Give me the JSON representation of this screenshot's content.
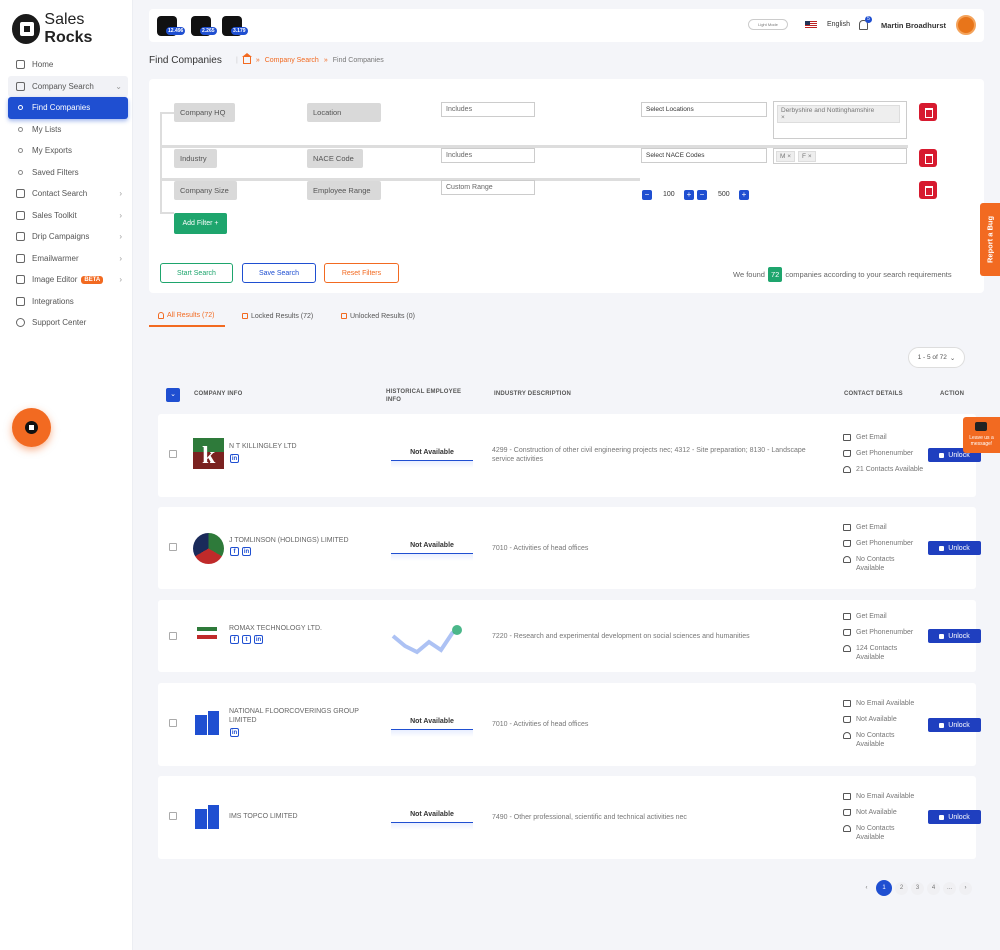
{
  "brand": {
    "name_a": "Sales ",
    "name_b": "Rocks"
  },
  "sidebar": {
    "items": [
      {
        "label": "Home"
      },
      {
        "label": "Company Search"
      },
      {
        "label": "Find Companies"
      },
      {
        "label": "My Lists"
      },
      {
        "label": "My Exports"
      },
      {
        "label": "Saved Filters"
      },
      {
        "label": "Contact Search"
      },
      {
        "label": "Sales Toolkit"
      },
      {
        "label": "Drip Campaigns"
      },
      {
        "label": "Emailwarmer"
      },
      {
        "label": "Image Editor",
        "badge": "BETA"
      },
      {
        "label": "Integrations"
      },
      {
        "label": "Support Center"
      }
    ]
  },
  "topbar": {
    "counters": [
      "12.496",
      "2.265",
      "3.179"
    ],
    "toggle_label": "Light Mode",
    "language": "English",
    "notifications": "5",
    "user": "Martin Broadhurst"
  },
  "page": {
    "title": "Find Companies",
    "breadcrumb": [
      "Company Search",
      "Find Companies"
    ]
  },
  "filters": {
    "rows": [
      {
        "field": "Company HQ",
        "subfield": "Location",
        "mode": "Includes",
        "select": "Select Locations",
        "tags": [
          "Derbyshire and Nottinghamshire"
        ]
      },
      {
        "field": "Industry",
        "subfield": "NACE Code",
        "mode": "Includes",
        "select": "Select NACE Codes",
        "tags": [
          "M",
          "F"
        ]
      },
      {
        "field": "Company Size",
        "subfield": "Employee Range",
        "mode": "Custom Range",
        "min": "100",
        "max": "500"
      }
    ],
    "add_filter": "Add Filter +",
    "start_search": "Start Search",
    "save_search": "Save Search",
    "reset_filters": "Reset Filters",
    "found_prefix": "We found",
    "found_count": "72",
    "found_suffix": "companies according to your search requirements"
  },
  "tabs": {
    "all": "All Results (72)",
    "locked": "Locked Results (72)",
    "unlocked": "Unlocked Results (0)"
  },
  "pager_top": "1 - 5 of 72",
  "table": {
    "headers": {
      "company": "COMPANY INFO",
      "history": "HISTORICAL EMPLOYEE INFO",
      "industry": "INDUSTRY DESCRIPTION",
      "contact": "CONTACT DETAILS",
      "action": "ACTION"
    },
    "rows": [
      {
        "name": "N T KILLINGLEY LTD",
        "history": "Not Available",
        "industry": "4299 - Construction of other civil engineering projects nec; 4312 - Site preparation; 8130 - Landscape service activities",
        "email": "Get Email",
        "phone": "Get Phonenumber",
        "contacts": "21 Contacts Available",
        "action": "Unlock"
      },
      {
        "name": "J TOMLINSON (HOLDINGS) LIMITED",
        "history": "Not Available",
        "industry": "7010 - Activities of head offices",
        "email": "Get Email",
        "phone": "Get Phonenumber",
        "contacts": "No Contacts Available",
        "action": "Unlock"
      },
      {
        "name": "ROMAX TECHNOLOGY LTD.",
        "history": "",
        "industry": "7220 - Research and experimental development on social sciences and humanities",
        "email": "Get Email",
        "phone": "Get Phonenumber",
        "contacts": "124 Contacts Available",
        "action": "Unlock"
      },
      {
        "name": "NATIONAL FLOORCOVERINGS GROUP LIMITED",
        "history": "Not Available",
        "industry": "7010 - Activities of head offices",
        "email": "No Email Available",
        "phone": "Not Available",
        "contacts": "No Contacts Available",
        "action": "Unlock"
      },
      {
        "name": "IMS TOPCO LIMITED",
        "history": "Not Available",
        "industry": "7490 - Other professional, scientific and technical activities nec",
        "email": "No Email Available",
        "phone": "Not Available",
        "contacts": "No Contacts Available",
        "action": "Unlock"
      }
    ]
  },
  "pagination": {
    "pages": [
      "1",
      "2",
      "3",
      "4",
      "..."
    ],
    "prev": "‹",
    "next": "›"
  },
  "report_bug": "Report a Bug",
  "leave_message": "Leave us a message!",
  "colors": {
    "accent": "#f26a21",
    "primary": "#1f4fd1",
    "success": "#1ea56d",
    "danger": "#d71a2f"
  }
}
